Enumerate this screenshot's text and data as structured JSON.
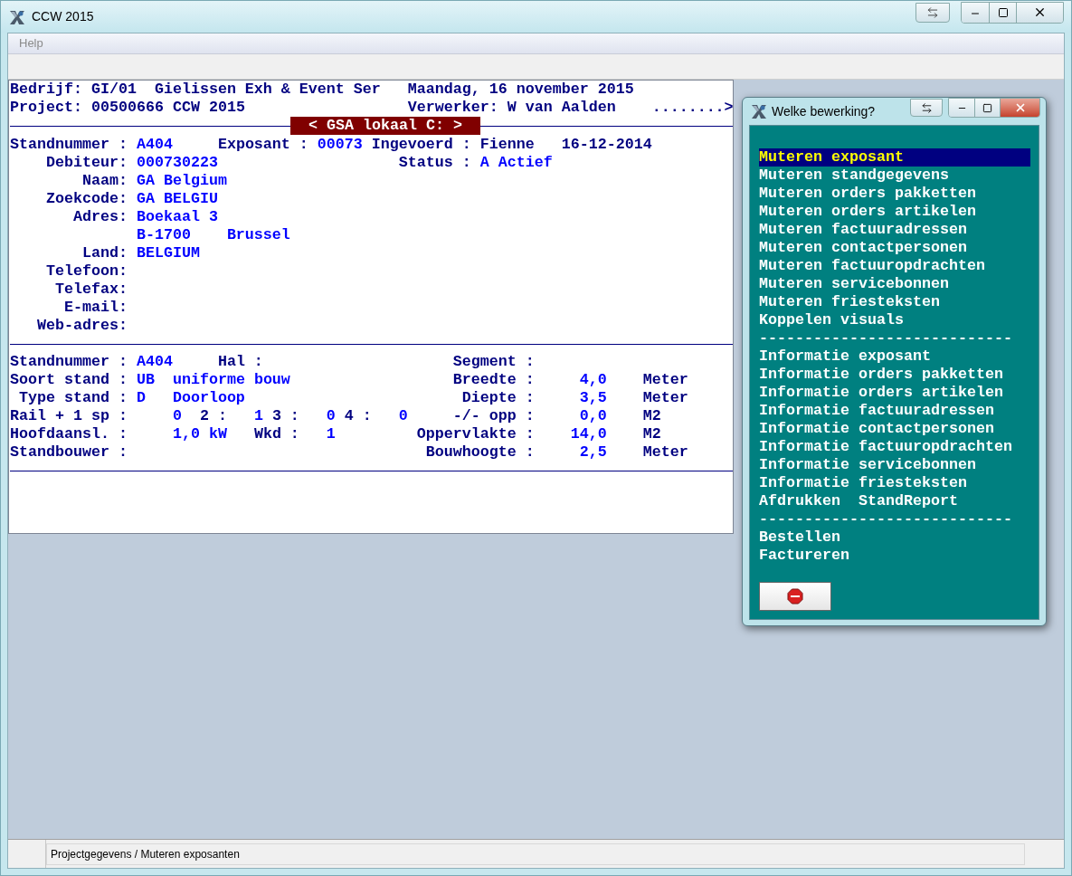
{
  "window": {
    "title": "CCW 2015"
  },
  "menu": [
    {
      "label": "Help",
      "disabled": true
    }
  ],
  "terminal": {
    "header": [
      [
        {
          "text": "Bedrijf:",
          "kind": "label"
        },
        {
          "text": "GI/01  Gielissen Exh & Event Ser",
          "kind": "label"
        },
        {
          "text": "Maandag, 16 november 2015",
          "kind": "label"
        }
      ],
      [
        {
          "text": "Project:",
          "kind": "label"
        },
        {
          "text": "00500666 CCW 2015",
          "kind": "label"
        },
        {
          "text": "Verwerker:",
          "kind": "label"
        },
        {
          "text": "W van Aalden",
          "kind": "label"
        },
        {
          "text": "........>",
          "kind": "label"
        }
      ]
    ],
    "badge": "< GSA lokaal C: >",
    "exhibitor": [
      [
        {
          "text": "Standnummer :",
          "kind": "label"
        },
        {
          "text": "A404",
          "kind": "value"
        },
        {
          "text": "Exposant :",
          "kind": "label"
        },
        {
          "text": "00073",
          "kind": "value"
        },
        {
          "text": "Ingevoerd :",
          "kind": "label"
        },
        {
          "text": "Fienne",
          "kind": "label"
        },
        {
          "text": "16-12-2014",
          "kind": "label"
        }
      ],
      [
        {
          "text": "Debiteur:",
          "kind": "label"
        },
        {
          "text": "000730223",
          "kind": "value"
        },
        {
          "text": "Status :",
          "kind": "label"
        },
        {
          "text": "A Actief",
          "kind": "value"
        }
      ],
      [
        {
          "text": "Naam:",
          "kind": "label"
        },
        {
          "text": "GA Belgium",
          "kind": "value"
        }
      ],
      [
        {
          "text": "Zoekcode:",
          "kind": "label"
        },
        {
          "text": "GA BELGIU",
          "kind": "value"
        }
      ],
      [
        {
          "text": "Adres:",
          "kind": "label"
        },
        {
          "text": "Boekaal 3",
          "kind": "value"
        }
      ],
      [
        {
          "text": "B-1700",
          "kind": "value"
        },
        {
          "text": "Brussel",
          "kind": "value"
        }
      ],
      [
        {
          "text": "Land:",
          "kind": "label"
        },
        {
          "text": "BELGIUM",
          "kind": "value"
        }
      ],
      [
        {
          "text": "Telefoon:",
          "kind": "label"
        }
      ],
      [
        {
          "text": "Telefax:",
          "kind": "label"
        }
      ],
      [
        {
          "text": "E-mail:",
          "kind": "label"
        }
      ],
      [
        {
          "text": "Web-adres:",
          "kind": "label"
        }
      ]
    ],
    "stand": [
      [
        {
          "text": "Standnummer :",
          "kind": "label"
        },
        {
          "text": "A404",
          "kind": "value"
        },
        {
          "text": "Hal :",
          "kind": "label"
        },
        {
          "text": "Segment :",
          "kind": "label"
        }
      ],
      [
        {
          "text": "Soort stand :",
          "kind": "label"
        },
        {
          "text": "UB",
          "kind": "value"
        },
        {
          "text": "uniforme bouw",
          "kind": "value"
        },
        {
          "text": "Breedte :",
          "kind": "label"
        },
        {
          "text": "4,0",
          "kind": "value"
        },
        {
          "text": "Meter",
          "kind": "label"
        }
      ],
      [
        {
          "text": "Type stand :",
          "kind": "label"
        },
        {
          "text": "D",
          "kind": "value"
        },
        {
          "text": "Doorloop",
          "kind": "value"
        },
        {
          "text": "Diepte :",
          "kind": "label"
        },
        {
          "text": "3,5",
          "kind": "value"
        },
        {
          "text": "Meter",
          "kind": "label"
        }
      ],
      [
        {
          "text": "Rail + 1 sp :",
          "kind": "label"
        },
        {
          "text": "0",
          "kind": "value"
        },
        {
          "text": "2 :",
          "kind": "label"
        },
        {
          "text": "1",
          "kind": "value"
        },
        {
          "text": "3 :",
          "kind": "label"
        },
        {
          "text": "0",
          "kind": "value"
        },
        {
          "text": "4 :",
          "kind": "label"
        },
        {
          "text": "0",
          "kind": "value"
        },
        {
          "text": "-/- opp :",
          "kind": "label"
        },
        {
          "text": "0,0",
          "kind": "value"
        },
        {
          "text": "M2",
          "kind": "label"
        }
      ],
      [
        {
          "text": "Hoofdaansl. :",
          "kind": "label"
        },
        {
          "text": "1,0 kW",
          "kind": "value"
        },
        {
          "text": "Wkd :",
          "kind": "label"
        },
        {
          "text": "1",
          "kind": "value"
        },
        {
          "text": "Oppervlakte :",
          "kind": "label"
        },
        {
          "text": "14,0",
          "kind": "value"
        },
        {
          "text": "M2",
          "kind": "label"
        }
      ],
      [
        {
          "text": "Standbouwer :",
          "kind": "label"
        },
        {
          "text": "Bouwhoogte :",
          "kind": "label"
        },
        {
          "text": "2,5",
          "kind": "value"
        },
        {
          "text": "Meter",
          "kind": "label"
        }
      ]
    ]
  },
  "dialog": {
    "title": "Welke bewerking?",
    "items": [
      {
        "kind": "item",
        "label": "Muteren exposant",
        "selected": true
      },
      {
        "kind": "item",
        "label": "Muteren standgegevens",
        "selected": false
      },
      {
        "kind": "item",
        "label": "Muteren orders pakketten",
        "selected": false
      },
      {
        "kind": "item",
        "label": "Muteren orders artikelen",
        "selected": false
      },
      {
        "kind": "item",
        "label": "Muteren factuuradressen",
        "selected": false
      },
      {
        "kind": "item",
        "label": "Muteren contactpersonen",
        "selected": false
      },
      {
        "kind": "item",
        "label": "Muteren factuuropdrachten",
        "selected": false
      },
      {
        "kind": "item",
        "label": "Muteren servicebonnen",
        "selected": false
      },
      {
        "kind": "item",
        "label": "Muteren friesteksten",
        "selected": false
      },
      {
        "kind": "item",
        "label": "Koppelen visuals",
        "selected": false
      },
      {
        "kind": "separator",
        "label": "----------------------------"
      },
      {
        "kind": "item",
        "label": "Informatie exposant",
        "selected": false
      },
      {
        "kind": "item",
        "label": "Informatie orders pakketten",
        "selected": false
      },
      {
        "kind": "item",
        "label": "Informatie orders artikelen",
        "selected": false
      },
      {
        "kind": "item",
        "label": "Informatie factuuradressen",
        "selected": false
      },
      {
        "kind": "item",
        "label": "Informatie contactpersonen",
        "selected": false
      },
      {
        "kind": "item",
        "label": "Informatie factuuropdrachten",
        "selected": false
      },
      {
        "kind": "item",
        "label": "Informatie servicebonnen",
        "selected": false
      },
      {
        "kind": "item",
        "label": "Informatie friesteksten",
        "selected": false
      },
      {
        "kind": "item",
        "label": "Afdrukken  StandReport",
        "selected": false
      },
      {
        "kind": "separator",
        "label": "----------------------------"
      },
      {
        "kind": "item",
        "label": "Bestellen",
        "selected": false
      },
      {
        "kind": "item",
        "label": "Factureren",
        "selected": false
      }
    ]
  },
  "status_bar": {
    "text": "Projectgegevens / Muteren exposanten"
  }
}
